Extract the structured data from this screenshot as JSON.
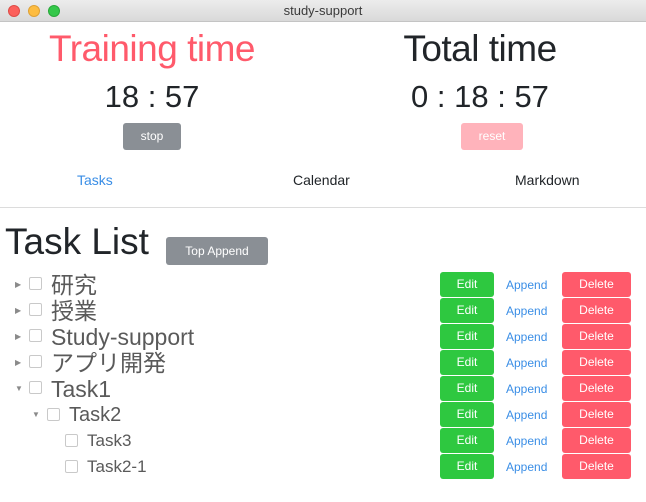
{
  "window": {
    "title": "study-support"
  },
  "training": {
    "title": "Training time",
    "value": "18 : 57",
    "button": "stop"
  },
  "total": {
    "title": "Total time",
    "value": "0 : 18 : 57",
    "button": "reset"
  },
  "nav": {
    "tasks": "Tasks",
    "calendar": "Calendar",
    "markdown": "Markdown"
  },
  "task_list": {
    "title": "Task List",
    "top_append_label": "Top Append",
    "edit_label": "Edit",
    "append_label": "Append",
    "delete_label": "Delete",
    "tasks": [
      {
        "name": "研究",
        "level": 0,
        "expanded": false
      },
      {
        "name": "授業",
        "level": 0,
        "expanded": false
      },
      {
        "name": "Study-support",
        "level": 0,
        "expanded": false
      },
      {
        "name": "アプリ開発",
        "level": 0,
        "expanded": false
      },
      {
        "name": "Task1",
        "level": 0,
        "expanded": true
      },
      {
        "name": "Task2",
        "level": 1,
        "expanded": true
      },
      {
        "name": "Task3",
        "level": 2,
        "expanded": false
      },
      {
        "name": "Task2-1",
        "level": 2,
        "expanded": false
      }
    ]
  },
  "colors": {
    "training_title": "#ff5a6b",
    "stop_button": "#8a8f95",
    "reset_button": "#ffb3bb",
    "edit_button": "#2ec840",
    "delete_button": "#ff5a6b",
    "link": "#3a8ee6"
  }
}
